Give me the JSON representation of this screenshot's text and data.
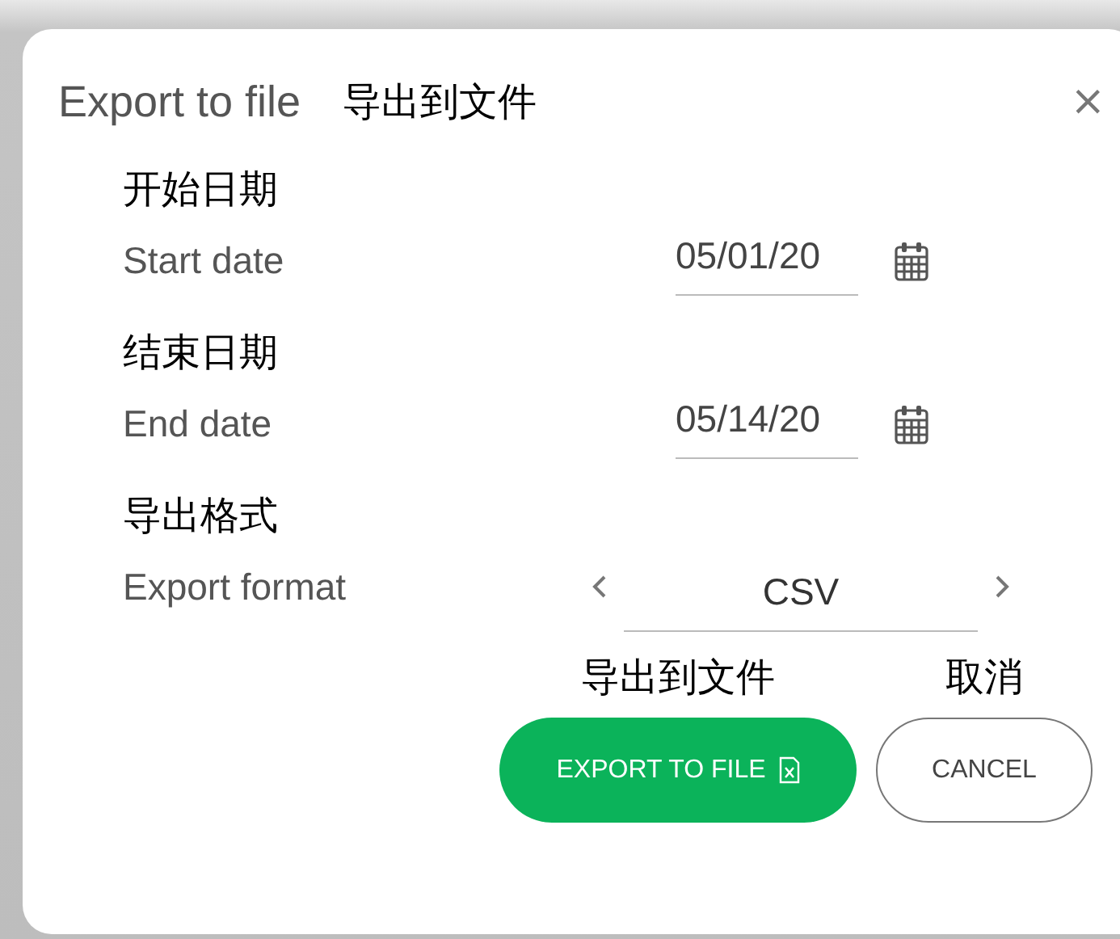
{
  "dialog": {
    "title": "Export to file",
    "title_translation": "导出到文件",
    "close": "×"
  },
  "fields": [
    {
      "kind": "date",
      "translation": "开始日期",
      "label": "Start date",
      "value": "05/01/20"
    },
    {
      "kind": "date",
      "translation": "结束日期",
      "label": "End date",
      "value": "05/14/20"
    },
    {
      "kind": "selector",
      "translation": "导出格式",
      "label": "Export format",
      "value": "CSV"
    }
  ],
  "buttons": [
    {
      "kind": "primary",
      "translation": "导出到文件",
      "label": "EXPORT TO FILE"
    },
    {
      "kind": "secondary",
      "translation": "取消",
      "label": "CANCEL"
    }
  ]
}
